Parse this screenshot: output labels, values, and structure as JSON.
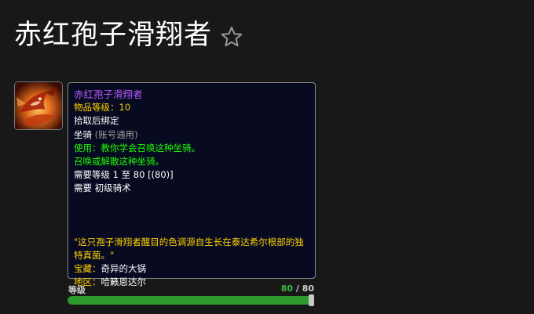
{
  "page": {
    "title": "赤红孢子滑翔者"
  },
  "icons": {
    "favorite": "star-outline-icon",
    "item": "red-spore-glider-icon"
  },
  "tooltip": {
    "name": "赤红孢子滑翔者",
    "item_level_label": "物品等级：",
    "item_level_value": "10",
    "binding": "拾取后绑定",
    "type": "坐骑",
    "type_note": "(账号通用)",
    "use_text": "使用：教你学会召唤这种坐骑。",
    "summon_text": "召唤或解散这种坐骑。",
    "required_level": "需要等级 1 至 80 [(80)]",
    "required_skill": "需要 初级骑术",
    "flavor": "\"这只孢子滑翔者醒目的色调源自生长在泰达希尔根部的独特真菌。\"",
    "source_label": "宝藏：",
    "source_value": "奇异的大锅",
    "zone_label": "地区：",
    "zone_value": "哈籁恩达尔"
  },
  "level": {
    "label": "等级",
    "current": "80",
    "separator": " / ",
    "max": "80",
    "fill_fraction": 1.0
  },
  "colors": {
    "epic_purple": "#b05cff",
    "gold": "#ffd100",
    "green": "#1eff00",
    "bar_green": "#2e9a2e"
  }
}
